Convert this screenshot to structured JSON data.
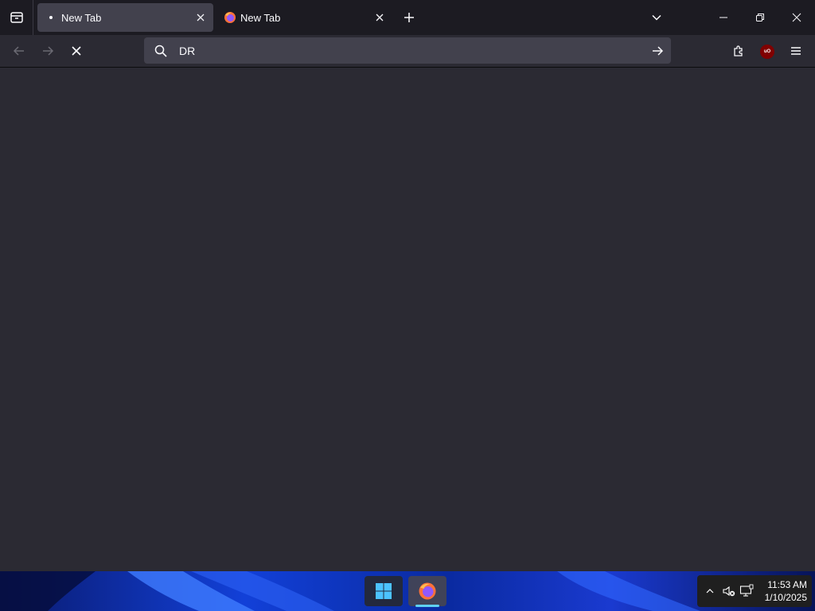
{
  "tabs": [
    {
      "title": "New Tab",
      "active": true,
      "favicon": "dot-icon"
    },
    {
      "title": "New Tab",
      "active": false,
      "favicon": "firefox-icon"
    }
  ],
  "urlbar": {
    "value": "DR",
    "search_icon": "search-icon",
    "go_icon": "arrow-right-icon"
  },
  "navigation": {
    "back_icon": "arrow-left-icon",
    "forward_icon": "arrow-right-icon",
    "stop_icon": "close-icon"
  },
  "toolbar": {
    "extensions_icon": "puzzle-icon",
    "ublock_badge": "uO",
    "menu_icon": "hamburger-icon"
  },
  "taskbar": {
    "time": "11:53 AM",
    "date": "1/10/2025",
    "apps": [
      "start-icon",
      "firefox-icon"
    ]
  },
  "colors": {
    "tabstrip_bg": "#1c1b22",
    "active_tab_bg": "#42414d",
    "toolbar_bg": "#2b2a33",
    "content_bg": "#2b2a33",
    "ublock_red": "#800000",
    "taskbar_accent": "#5fd0f2"
  }
}
